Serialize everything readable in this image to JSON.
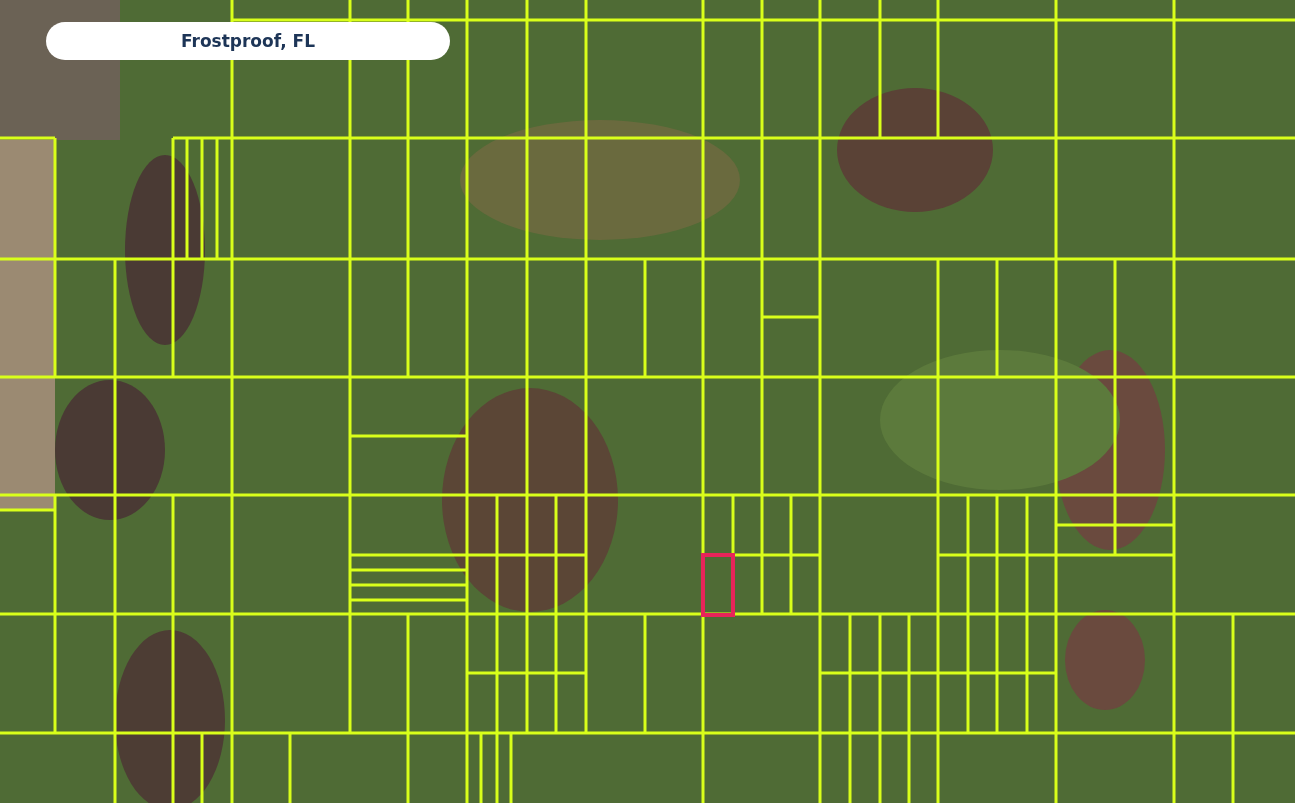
{
  "location_label": {
    "text": "Frostproof, FL"
  }
}
